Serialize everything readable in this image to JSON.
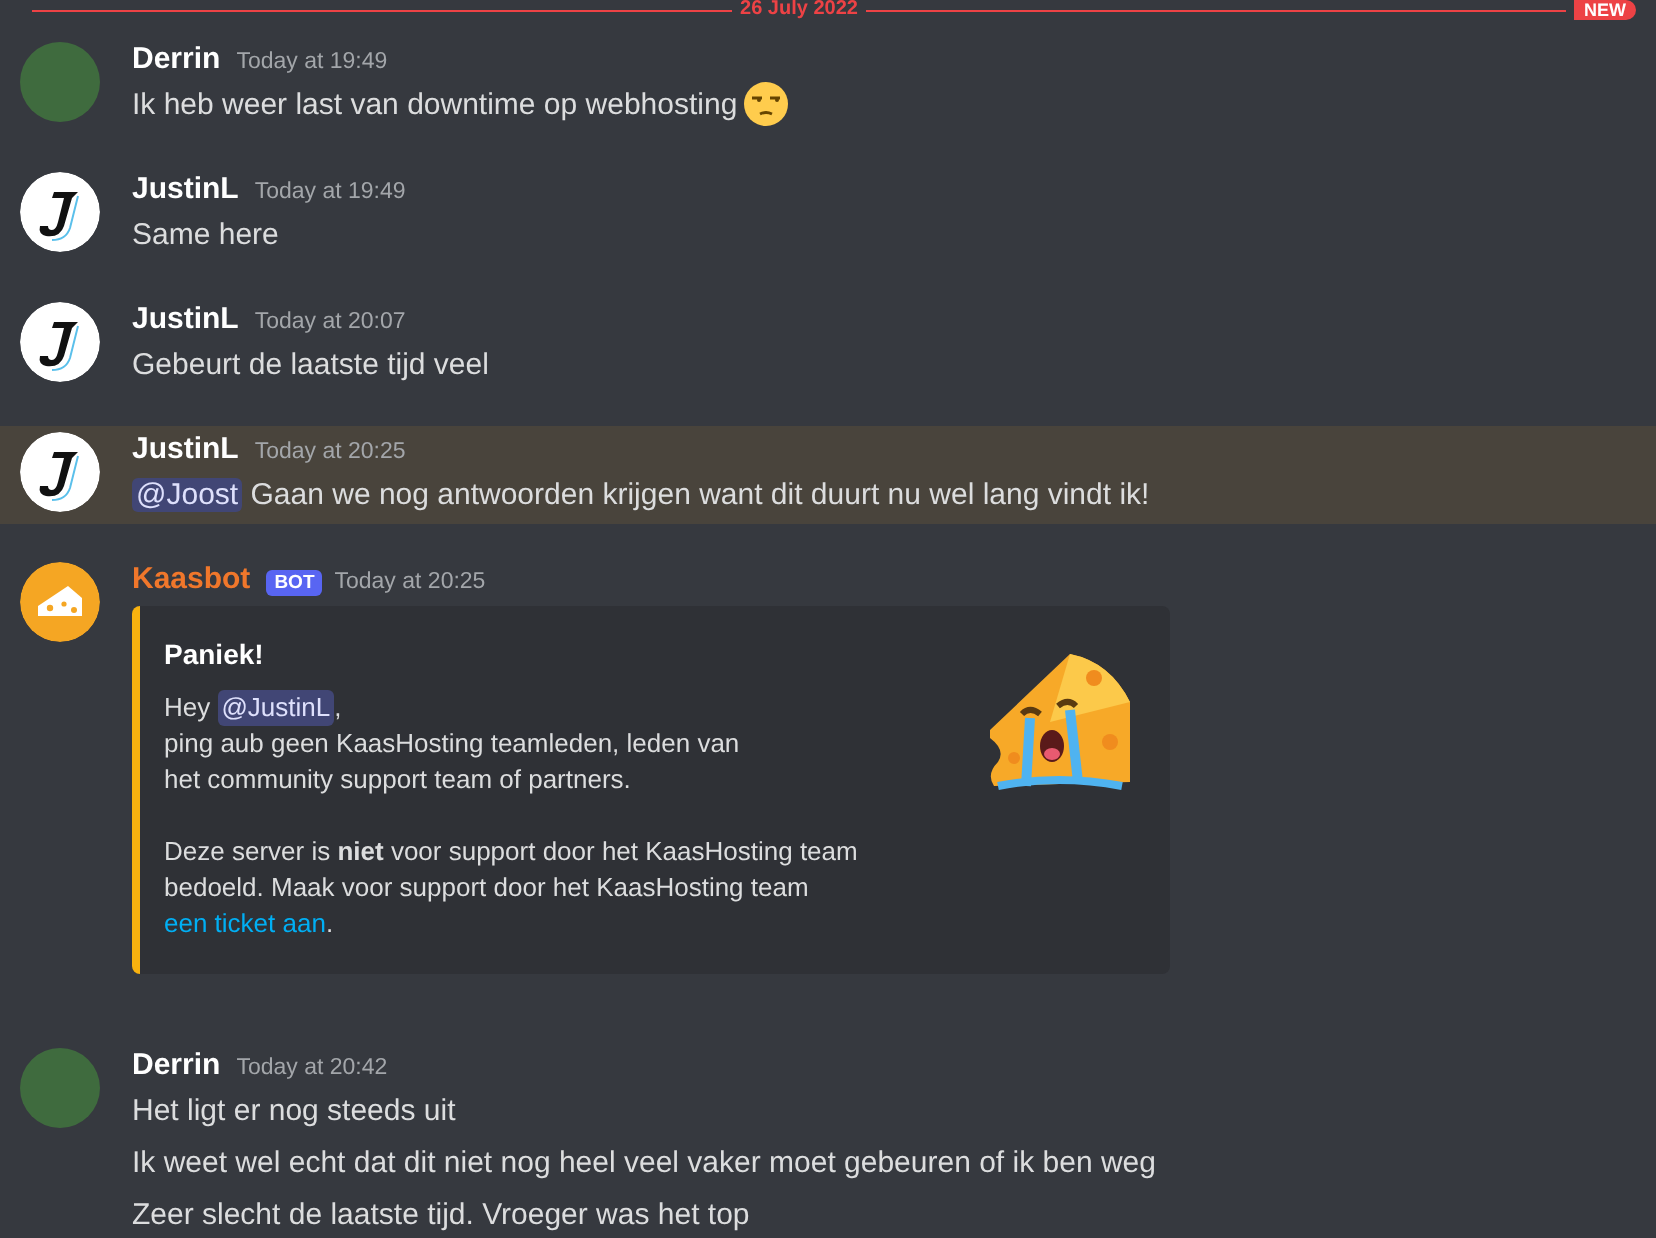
{
  "divider": {
    "date": "26 July 2022",
    "badge": "NEW"
  },
  "messages": [
    {
      "kind": "photo",
      "author": "Derrin",
      "color": "#ffffff",
      "time": "Today at 19:49",
      "lines": [
        {
          "parts": [
            {
              "kind": "text",
              "text": "Ik heb weer last van downtime op webhosting"
            },
            {
              "kind": "emoji"
            }
          ]
        }
      ]
    },
    {
      "kind": "letter",
      "author": "JustinL",
      "color": "#ffffff",
      "time": "Today at 19:49",
      "lines": [
        {
          "parts": [
            {
              "kind": "text",
              "text": "Same here"
            }
          ]
        }
      ]
    },
    {
      "kind": "letter",
      "author": "JustinL",
      "color": "#ffffff",
      "time": "Today at 20:07",
      "lines": [
        {
          "parts": [
            {
              "kind": "text",
              "text": "Gebeurt de laatste tijd veel"
            }
          ]
        }
      ]
    },
    {
      "kind": "letter",
      "author": "JustinL",
      "color": "#ffffff",
      "time": "Today at 20:25",
      "highlighted": true,
      "lines": [
        {
          "parts": [
            {
              "kind": "mention",
              "text": "@Joost"
            },
            {
              "kind": "text",
              "text": " Gaan we nog antwoorden krijgen want dit duurt nu wel lang vindt ik!"
            }
          ]
        }
      ]
    },
    {
      "kind": "bot",
      "author": "Kaasbot",
      "color": "#f0772b",
      "tag": "BOT",
      "time": "Today at 20:25",
      "embed": {
        "color": "#f8b20f",
        "title": "Paniek!",
        "paragraphs": [
          {
            "lines": [
              [
                {
                  "kind": "text",
                  "text": "Hey "
                },
                {
                  "kind": "mention",
                  "text": "@JustinL"
                },
                {
                  "kind": "text",
                  "text": ","
                }
              ],
              [
                {
                  "kind": "text",
                  "text": "ping aub geen KaasHosting teamleden, leden van"
                }
              ],
              [
                {
                  "kind": "text",
                  "text": "het community support team of partners."
                }
              ]
            ]
          },
          {
            "lines": [
              [
                {
                  "kind": "text",
                  "text": "Deze server is **niet** voor support door het KaasHosting team"
                }
              ],
              [
                {
                  "kind": "text",
                  "text": "bedoeld. Maak voor support door het KaasHosting team"
                }
              ],
              [
                {
                  "kind": "link",
                  "text": "een ticket aan"
                },
                {
                  "kind": "text",
                  "text": "."
                }
              ]
            ]
          }
        ]
      }
    },
    {
      "kind": "photo",
      "author": "Derrin",
      "color": "#ffffff",
      "time": "Today at 20:42",
      "lines": [
        {
          "parts": [
            {
              "kind": "text",
              "text": "Het ligt er nog steeds uit"
            }
          ]
        },
        {
          "parts": [
            {
              "kind": "text",
              "text": "Ik weet wel echt dat dit niet nog heel veel vaker moet gebeuren of ik ben weg"
            }
          ]
        },
        {
          "parts": [
            {
              "kind": "text",
              "text": "Zeer slecht de laatste tijd. Vroeger was het top"
            }
          ]
        }
      ]
    }
  ]
}
